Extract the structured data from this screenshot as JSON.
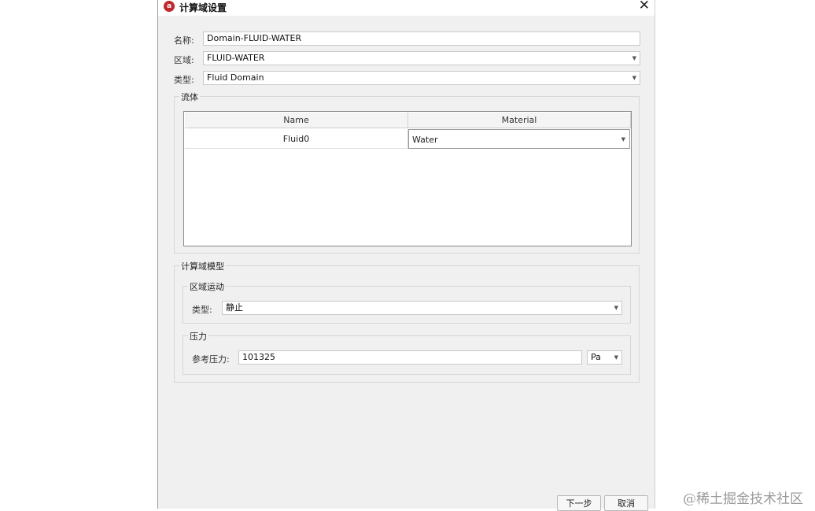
{
  "window": {
    "title": "计算域设置",
    "app_icon_glyph": "a"
  },
  "form": {
    "name_label": "名称:",
    "name_value": "Domain-FLUID-WATER",
    "region_label": "区域:",
    "region_value": "FLUID-WATER",
    "type_label": "类型:",
    "type_value": "Fluid Domain"
  },
  "fluid": {
    "group_title": "流体",
    "columns": [
      "Name",
      "Material"
    ],
    "rows": [
      {
        "name": "Fluid0",
        "material": "Water"
      }
    ]
  },
  "model": {
    "group_title": "计算域模型",
    "motion": {
      "group_title": "区域运动",
      "type_label": "类型:",
      "type_value": "静止"
    },
    "pressure": {
      "group_title": "压力",
      "ref_label": "参考压力:",
      "ref_value": "101325",
      "unit": "Pa"
    }
  },
  "buttons": {
    "next": "下一步",
    "cancel": "取消"
  },
  "watermark": "@稀土掘金技术社区"
}
